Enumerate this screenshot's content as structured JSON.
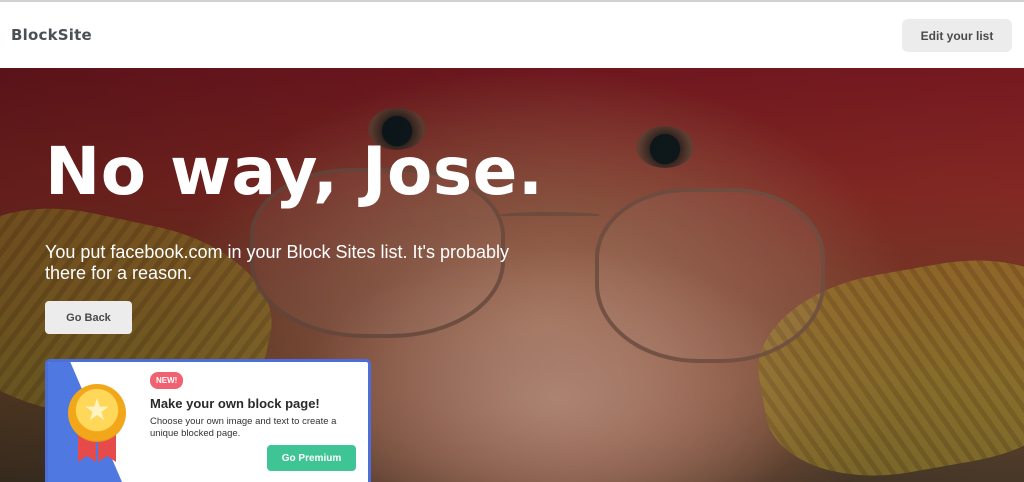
{
  "header": {
    "logo": "BlockSite",
    "edit_list_label": "Edit your list"
  },
  "hero": {
    "headline": "No way, Jose.",
    "message": "You put facebook.com in your Block Sites list. It's probably there for a reason.",
    "back_label": "Go Back"
  },
  "promo": {
    "badge": "NEW!",
    "title": "Make your own block page!",
    "description": "Choose your own image and text to create a unique blocked page.",
    "cta_label": "Go Premium",
    "icon": "medal-star-icon"
  },
  "colors": {
    "accent_green": "#3fc495",
    "promo_border": "#4c6ed8",
    "badge_red": "#f06272"
  }
}
